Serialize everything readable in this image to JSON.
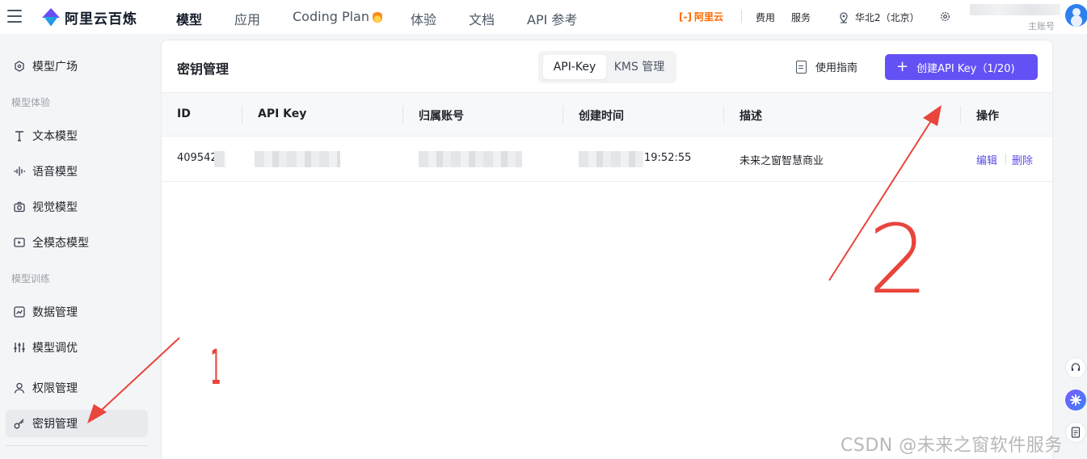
{
  "header": {
    "logo_text": "阿里云百炼",
    "nav": [
      {
        "label": "模型",
        "active": true
      },
      {
        "label": "应用",
        "active": false
      },
      {
        "label": "Coding Plan",
        "active": false,
        "icon": "fire-icon"
      },
      {
        "label": "体验",
        "active": false
      },
      {
        "label": "文档",
        "active": false
      },
      {
        "label": "API 参考",
        "active": false
      }
    ],
    "aliyun_bracket": "[-]",
    "aliyun_label": "阿里云",
    "tools": {
      "fee": "费用",
      "service": "服务"
    },
    "region": "华北2（北京）",
    "sub_account": "主账号"
  },
  "sidebar": {
    "items": [
      {
        "label": "模型广场",
        "icon": "model-square-icon",
        "active": false
      },
      {
        "label": "文本模型",
        "icon": "text-model-icon",
        "active": false
      },
      {
        "label": "语音模型",
        "icon": "audio-wave-icon",
        "active": false
      },
      {
        "label": "视觉模型",
        "icon": "camera-icon",
        "active": false
      },
      {
        "label": "全模态模型",
        "icon": "multimodal-icon",
        "active": false
      },
      {
        "label": "数据管理",
        "icon": "chart-line-icon",
        "active": false
      },
      {
        "label": "模型调优",
        "icon": "tuning-sliders-icon",
        "active": false
      },
      {
        "label": "权限管理",
        "icon": "user-icon",
        "active": false
      },
      {
        "label": "密钥管理",
        "icon": "key-icon",
        "active": true
      }
    ],
    "groups": {
      "experience": "模型体验",
      "training": "模型训练"
    }
  },
  "main": {
    "title": "密钥管理",
    "tabs": [
      {
        "label": "API-Key",
        "active": true
      },
      {
        "label": "KMS 管理",
        "active": false
      }
    ],
    "guide_label": "使用指南",
    "create_button": "创建API Key（1/20)",
    "table": {
      "columns": [
        "ID",
        "API Key",
        "归属账号",
        "创建时间",
        "描述",
        "操作"
      ],
      "rows": [
        {
          "id": "409542",
          "created_time": "19:52:55",
          "description": "未来之窗智慧商业",
          "actions": [
            "编辑",
            "删除"
          ]
        }
      ]
    }
  },
  "watermark": "CSDN @未来之窗软件服务",
  "annotations": {
    "mark_1": "1",
    "mark_2": "2",
    "color": "#e8453c"
  },
  "colors": {
    "primary": "#6451f5",
    "link": "#5a4de8",
    "brand_orange": "#ff6a00"
  }
}
